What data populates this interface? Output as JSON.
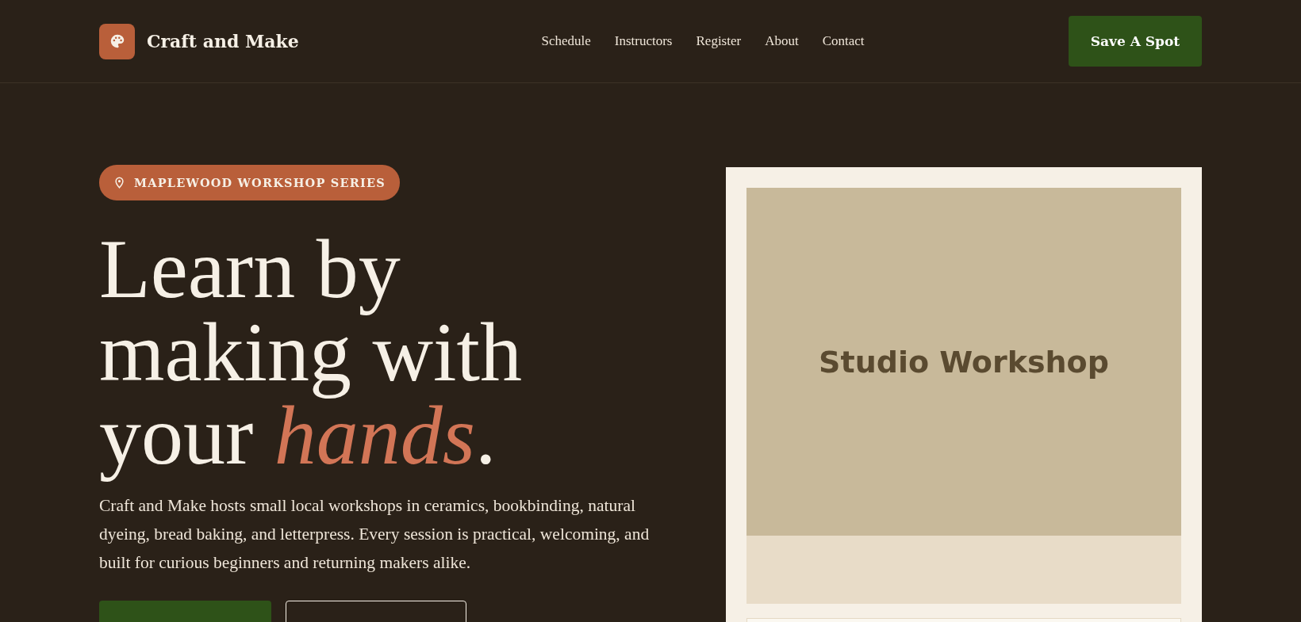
{
  "brand": {
    "name": "Craft and Make"
  },
  "nav": [
    {
      "label": "Schedule"
    },
    {
      "label": "Instructors"
    },
    {
      "label": "Register"
    },
    {
      "label": "About"
    },
    {
      "label": "Contact"
    }
  ],
  "header_button": {
    "label": "Save A Spot"
  },
  "badge": {
    "label": "MAPLEWOOD WORKSHOP SERIES"
  },
  "headline": {
    "lines": [
      "Learn by",
      "making with"
    ],
    "last_line_start": "your ",
    "highlight": "hands",
    "end": "."
  },
  "intro": "Craft and Make hosts small local workshops in ceramics, bookbinding, natural dyeing, bread baking, and letterpress. Every session is practical, welcoming, and built for curious beginners and returning makers alike.",
  "hero_buttons": [
    {
      "kind": "primary"
    },
    {
      "kind": "outline"
    }
  ],
  "card": {
    "image_label": "Studio Workshop"
  }
}
